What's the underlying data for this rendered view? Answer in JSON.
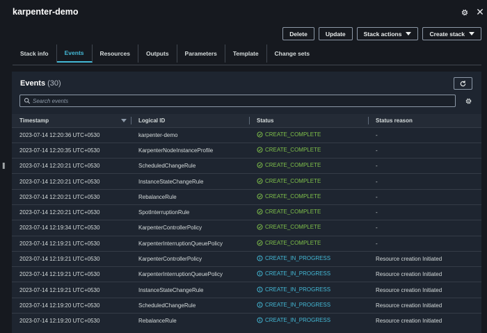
{
  "header": {
    "title": "karpenter-demo"
  },
  "actions": {
    "delete": "Delete",
    "update": "Update",
    "stack_actions": "Stack actions",
    "create_stack": "Create stack"
  },
  "tabs": [
    {
      "label": "Stack info",
      "active": false
    },
    {
      "label": "Events",
      "active": true
    },
    {
      "label": "Resources",
      "active": false
    },
    {
      "label": "Outputs",
      "active": false
    },
    {
      "label": "Parameters",
      "active": false
    },
    {
      "label": "Template",
      "active": false
    },
    {
      "label": "Change sets",
      "active": false
    }
  ],
  "events": {
    "title": "Events",
    "count": "(30)",
    "search_placeholder": "Search events",
    "columns": [
      "Timestamp",
      "Logical ID",
      "Status",
      "Status reason"
    ],
    "rows": [
      {
        "timestamp": "2023-07-14 12:20:36 UTC+0530",
        "logical_id": "karpenter-demo",
        "status": "CREATE_COMPLETE",
        "status_type": "complete",
        "reason": "-"
      },
      {
        "timestamp": "2023-07-14 12:20:35 UTC+0530",
        "logical_id": "KarpenterNodeInstanceProfile",
        "status": "CREATE_COMPLETE",
        "status_type": "complete",
        "reason": "-"
      },
      {
        "timestamp": "2023-07-14 12:20:21 UTC+0530",
        "logical_id": "ScheduledChangeRule",
        "status": "CREATE_COMPLETE",
        "status_type": "complete",
        "reason": "-"
      },
      {
        "timestamp": "2023-07-14 12:20:21 UTC+0530",
        "logical_id": "InstanceStateChangeRule",
        "status": "CREATE_COMPLETE",
        "status_type": "complete",
        "reason": "-"
      },
      {
        "timestamp": "2023-07-14 12:20:21 UTC+0530",
        "logical_id": "RebalanceRule",
        "status": "CREATE_COMPLETE",
        "status_type": "complete",
        "reason": "-"
      },
      {
        "timestamp": "2023-07-14 12:20:21 UTC+0530",
        "logical_id": "SpotInterruptionRule",
        "status": "CREATE_COMPLETE",
        "status_type": "complete",
        "reason": "-"
      },
      {
        "timestamp": "2023-07-14 12:19:34 UTC+0530",
        "logical_id": "KarpenterControllerPolicy",
        "status": "CREATE_COMPLETE",
        "status_type": "complete",
        "reason": "-"
      },
      {
        "timestamp": "2023-07-14 12:19:21 UTC+0530",
        "logical_id": "KarpenterInterruptionQueuePolicy",
        "status": "CREATE_COMPLETE",
        "status_type": "complete",
        "reason": "-"
      },
      {
        "timestamp": "2023-07-14 12:19:21 UTC+0530",
        "logical_id": "KarpenterControllerPolicy",
        "status": "CREATE_IN_PROGRESS",
        "status_type": "progress",
        "reason": "Resource creation Initiated"
      },
      {
        "timestamp": "2023-07-14 12:19:21 UTC+0530",
        "logical_id": "KarpenterInterruptionQueuePolicy",
        "status": "CREATE_IN_PROGRESS",
        "status_type": "progress",
        "reason": "Resource creation Initiated"
      },
      {
        "timestamp": "2023-07-14 12:19:21 UTC+0530",
        "logical_id": "InstanceStateChangeRule",
        "status": "CREATE_IN_PROGRESS",
        "status_type": "progress",
        "reason": "Resource creation Initiated"
      },
      {
        "timestamp": "2023-07-14 12:19:20 UTC+0530",
        "logical_id": "ScheduledChangeRule",
        "status": "CREATE_IN_PROGRESS",
        "status_type": "progress",
        "reason": "Resource creation Initiated"
      },
      {
        "timestamp": "2023-07-14 12:19:20 UTC+0530",
        "logical_id": "RebalanceRule",
        "status": "CREATE_IN_PROGRESS",
        "status_type": "progress",
        "reason": "Resource creation Initiated"
      }
    ]
  },
  "colors": {
    "accent": "#44b9d6",
    "complete": "#7fc04a",
    "background": "#16191f"
  },
  "icons": {
    "settings": "gear-icon",
    "close": "close-icon",
    "refresh": "refresh-icon",
    "search": "search-icon",
    "complete": "check-circle-icon",
    "progress": "info-circle-icon"
  }
}
